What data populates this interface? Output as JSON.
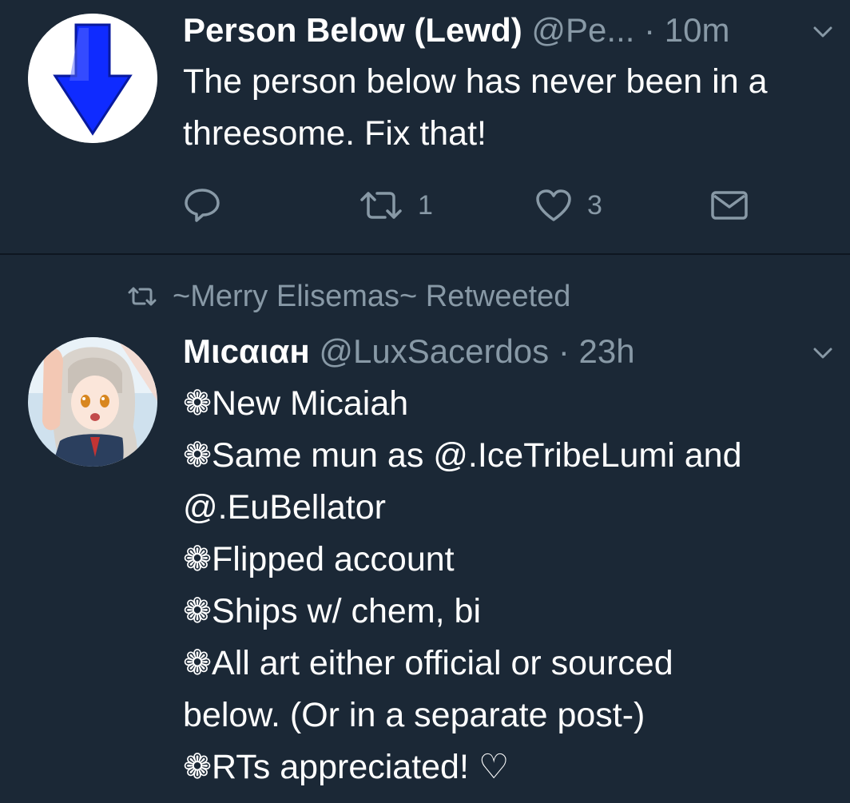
{
  "tweets": [
    {
      "display_name": "Person Below (Lewd)",
      "handle": "@Pe...",
      "separator": "·",
      "time": "10m",
      "text": "The person below has never been in a threesome. Fix that!",
      "retweet_count": "1",
      "like_count": "3"
    },
    {
      "retweet_context": "~Merry Elisemas~ Retweeted",
      "display_name": "Mιcαιαн",
      "handle": "@LuxSacerdos",
      "separator": "·",
      "time": "23h",
      "lines": [
        "❁New Micaiah",
        "❁Same mun as @.IceTribeLumi and",
        "@.EuBellator",
        "❁Flipped account",
        "❁Ships w/ chem, bi",
        "❁All art either official or sourced",
        "below. (Or in a separate post-)",
        "❁RTs appreciated! ♡"
      ]
    }
  ],
  "icons": {
    "reply": "reply-icon",
    "retweet": "retweet-icon",
    "like": "heart-icon",
    "dm": "envelope-icon",
    "more": "chevron-down-icon",
    "avatar1": "down-arrow-avatar",
    "avatar2": "anime-girl-avatar"
  },
  "colors": {
    "background": "#1b2836",
    "text": "#ffffff",
    "secondary": "#8899a6",
    "arrow_blue": "#0f2bff"
  }
}
